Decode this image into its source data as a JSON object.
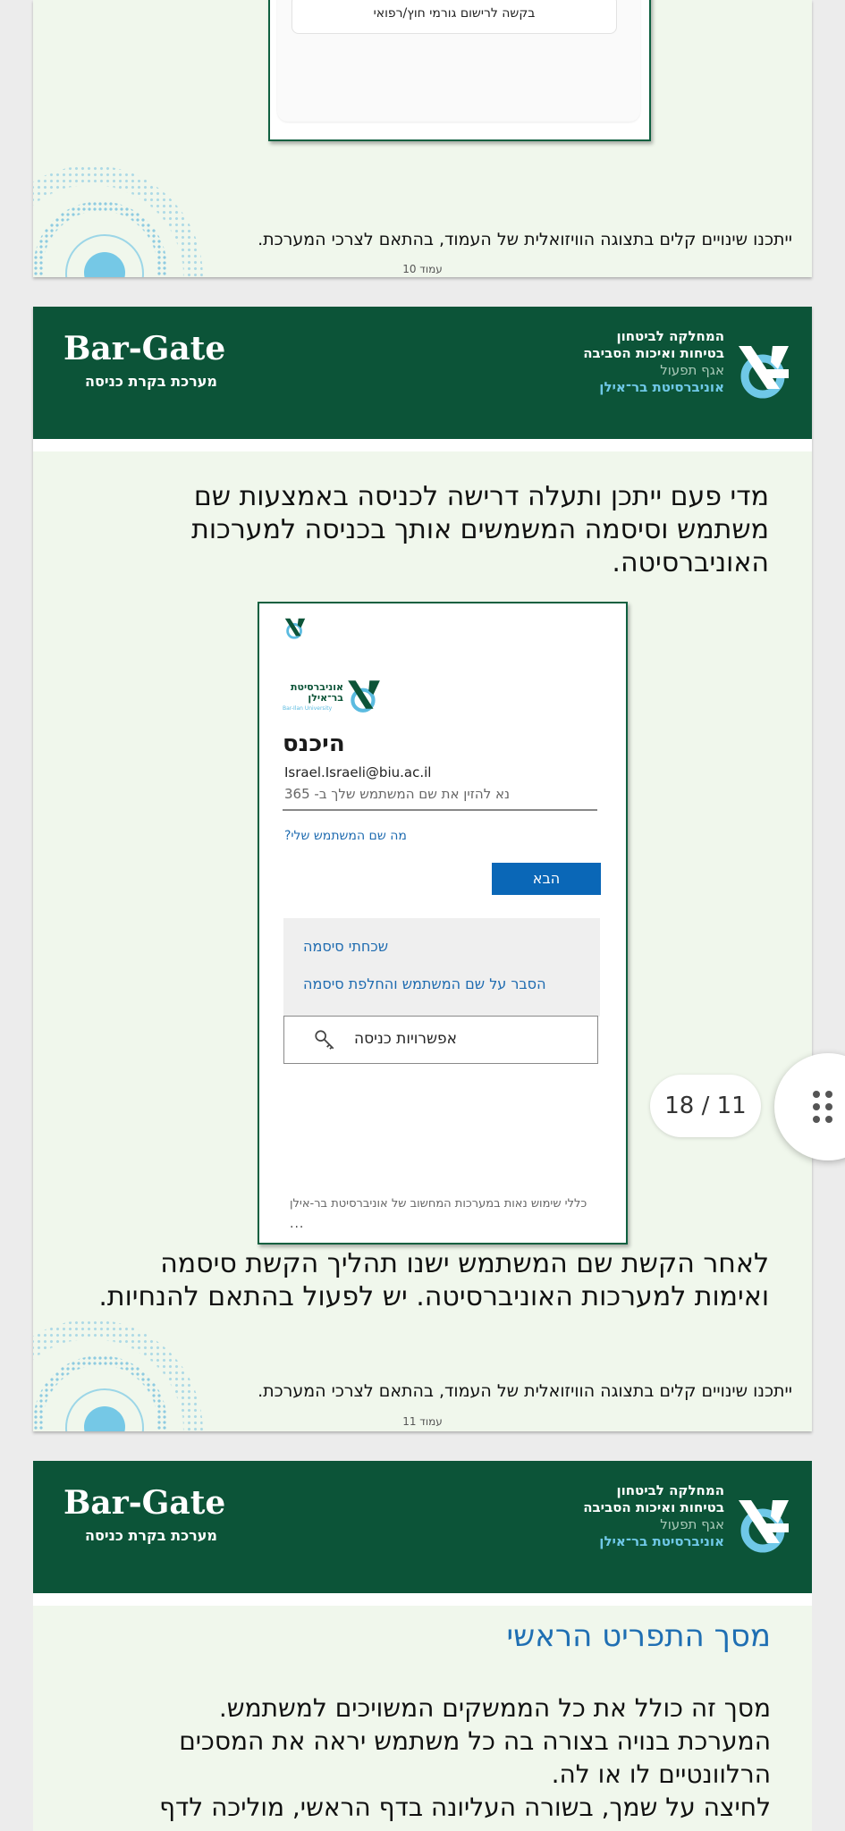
{
  "page10": {
    "request_button_label": "בקשה לרישום גורמי חוץ/רפואי",
    "footnote": "ייתכנו שינויים קלים בתצוגה הוויזואלית של העמוד, בהתאם לצרכי המערכת.",
    "page_label": "עמוד 10"
  },
  "header": {
    "brand_title": "Bar-Gate",
    "brand_subtitle": "מערכת בקרת כניסה",
    "dept_line1": "המחלקה לביטחון",
    "dept_line2": "בטיחות ואיכות הסביבה",
    "dept_line3": "אגף תפעול",
    "dept_line4": "אוניברסיטת בר־אילן"
  },
  "page11": {
    "intro_text": "מדי פעם ייתכן ותעלה דרישה לכניסה באמצעות שם משתמש וסיסמה המשמשים אותך בכניסה למערכות האוניברסיטה.",
    "signin": {
      "logo_text_line1": "אוניברסיטת",
      "logo_text_line2": "בר־אילן",
      "logo_text_line3": "Bar-Ilan University",
      "heading": "היכנס",
      "email": "Israel.Israeli@biu.ac.il",
      "placeholder": "נא להזין את שם המשתמש שלך ב- 365",
      "whats_my_username": "מה שם המשתמש שלי?",
      "next_button": "הבא",
      "forgot_password": "שכחתי סיסמה",
      "explain_username": "הסבר על שם המשתמש והחלפת סיסמה",
      "signin_options": "אפשרויות כניסה",
      "terms": "כללי שימוש נאות במערכות המחשוב של אוניברסיטת בר-אילן",
      "more": "..."
    },
    "after_text": "לאחר הקשת שם המשתמש ישנו תהליך הקשת סיסמה ואימות למערכות האוניברסיטה. יש לפעול בהתאם להנחיות.",
    "footnote": "ייתכנו שינויים קלים בתצוגה הוויזואלית של העמוד, בהתאם לצרכי המערכת.",
    "page_label": "עמוד 11"
  },
  "page12": {
    "title": "מסך התפריט הראשי",
    "line1": "מסך זה כולל את כל הממשקים המשויכים למשתמש.",
    "line2": "המערכת בנויה בצורה בה כל משתמש יראה את המסכים",
    "line3": "הרלוונטיים לו או לה.",
    "line4": "לחיצה על שמך, בשורה העליונה בדף הראשי, מוליכה לדף"
  },
  "pager": {
    "text": "18 / 11"
  },
  "colors": {
    "brand_green": "#0c5438",
    "accent_blue": "#0a67b7",
    "page_bg": "#f0f7ec"
  }
}
